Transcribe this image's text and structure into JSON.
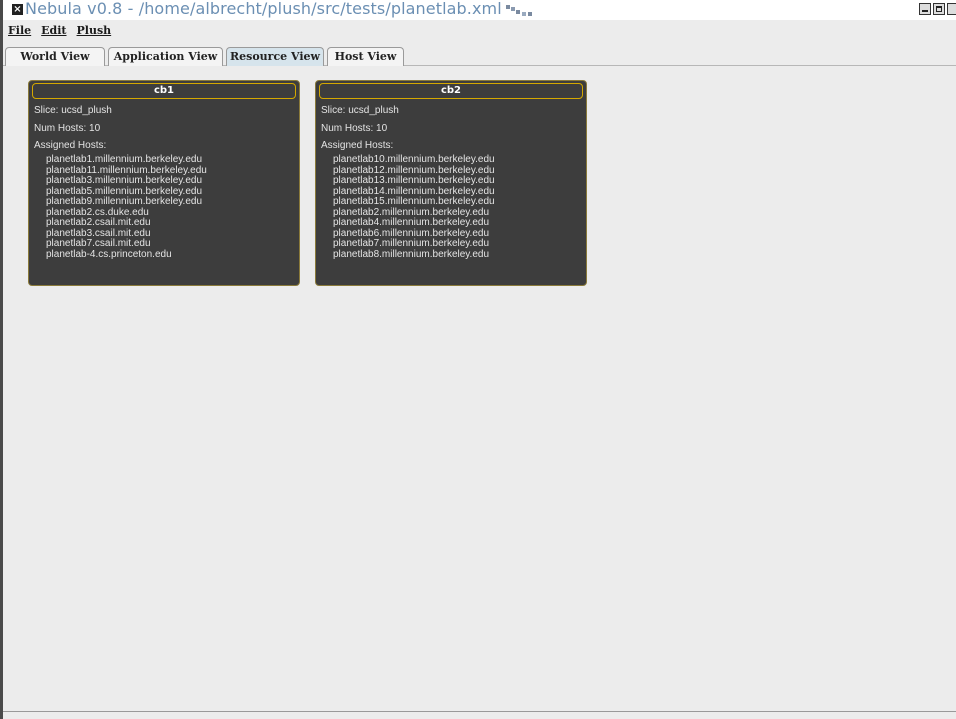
{
  "window": {
    "title": "Nebula v0.8 - /home/albrecht/plush/src/tests/planetlab.xml"
  },
  "menu": [
    {
      "label": "File"
    },
    {
      "label": "Edit"
    },
    {
      "label": "Plush"
    }
  ],
  "tabs": [
    {
      "label": "World View",
      "active": false
    },
    {
      "label": "Application View",
      "active": false
    },
    {
      "label": "Resource View",
      "active": true
    },
    {
      "label": "Host View",
      "active": false
    }
  ],
  "slices": [
    {
      "name": "cb1",
      "slice_line": "Slice: ucsd_plush",
      "num_hosts_line": "Num Hosts: 10",
      "assigned_label": "Assigned Hosts:",
      "hosts": [
        "planetlab1.millennium.berkeley.edu",
        "planetlab11.millennium.berkeley.edu",
        "planetlab3.millennium.berkeley.edu",
        "planetlab5.millennium.berkeley.edu",
        "planetlab9.millennium.berkeley.edu",
        "planetlab2.cs.duke.edu",
        "planetlab2.csail.mit.edu",
        "planetlab3.csail.mit.edu",
        "planetlab7.csail.mit.edu",
        "planetlab-4.cs.princeton.edu"
      ]
    },
    {
      "name": "cb2",
      "slice_line": "Slice: ucsd_plush",
      "num_hosts_line": "Num Hosts: 10",
      "assigned_label": "Assigned Hosts:",
      "hosts": [
        "planetlab10.millennium.berkeley.edu",
        "planetlab12.millennium.berkeley.edu",
        "planetlab13.millennium.berkeley.edu",
        "planetlab14.millennium.berkeley.edu",
        "planetlab15.millennium.berkeley.edu",
        "planetlab2.millennium.berkeley.edu",
        "planetlab4.millennium.berkeley.edu",
        "planetlab6.millennium.berkeley.edu",
        "planetlab7.millennium.berkeley.edu",
        "planetlab8.millennium.berkeley.edu"
      ]
    }
  ]
}
